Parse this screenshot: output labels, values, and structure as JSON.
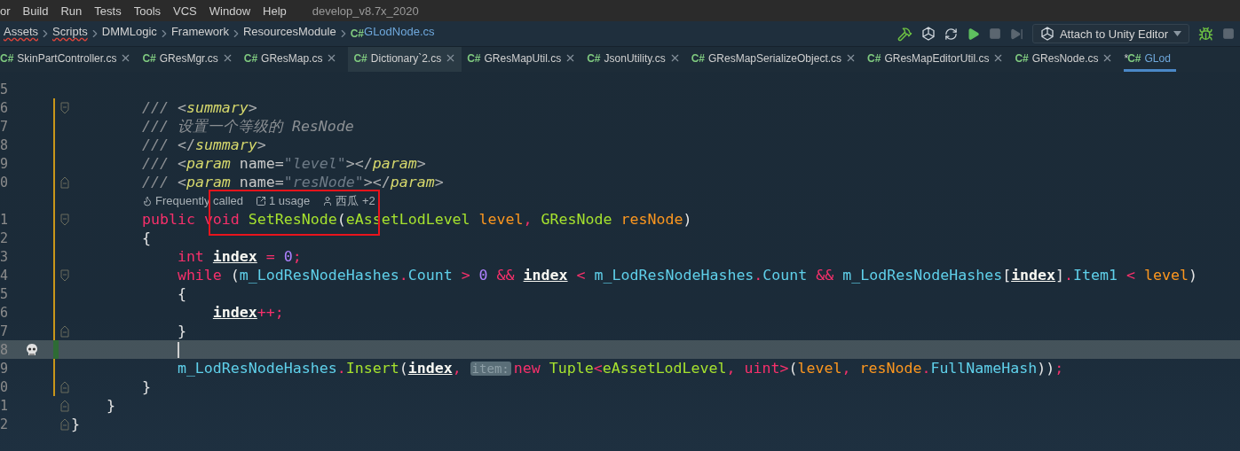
{
  "menu": {
    "items": [
      {
        "label": "or"
      },
      {
        "label": "Build"
      },
      {
        "label": "Run"
      },
      {
        "label": "Tests"
      },
      {
        "label": "Tools"
      },
      {
        "label": "VCS"
      },
      {
        "label": "Window"
      },
      {
        "label": "Help"
      }
    ],
    "project": "develop_v8.7x_2020"
  },
  "breadcrumb": [
    {
      "label": "Assets",
      "typo": true,
      "file": false
    },
    {
      "label": "Scripts",
      "typo": true,
      "file": false
    },
    {
      "label": "DMMLogic",
      "typo": false,
      "file": false
    },
    {
      "label": "Framework",
      "typo": false,
      "file": false
    },
    {
      "label": "ResourcesModule",
      "typo": false,
      "file": false
    },
    {
      "label": "GLodNode.cs",
      "typo": false,
      "file": true,
      "lang": "C#"
    }
  ],
  "toolbar": {
    "run_config": "Attach to Unity Editor"
  },
  "tabs": [
    {
      "lang": "C#",
      "label": "SkinPartController.cs",
      "selected": false,
      "hovered": false,
      "close": true
    },
    {
      "lang": "C#",
      "label": "GResMgr.cs",
      "selected": false,
      "hovered": false,
      "close": true
    },
    {
      "lang": "C#",
      "label": "GResMap.cs",
      "selected": false,
      "hovered": false,
      "close": true
    },
    {
      "lang": "C#",
      "label": "Dictionary`2.cs",
      "selected": false,
      "hovered": true,
      "close": true
    },
    {
      "lang": "C#",
      "label": "GResMapUtil.cs",
      "selected": false,
      "hovered": false,
      "close": true
    },
    {
      "lang": "C#",
      "label": "JsonUtility.cs",
      "selected": false,
      "hovered": false,
      "close": true
    },
    {
      "lang": "C#",
      "label": "GResMapSerializeObject.cs",
      "selected": false,
      "hovered": false,
      "close": true
    },
    {
      "lang": "C#",
      "label": "GResMapEditorUtil.cs",
      "selected": false,
      "hovered": false,
      "close": true
    },
    {
      "lang": "C#",
      "label": "GResNode.cs",
      "selected": false,
      "hovered": false,
      "close": true
    },
    {
      "lang": "C#",
      "label": "GLod",
      "selected": true,
      "hovered": false,
      "close": false,
      "modified_mark": "*"
    }
  ],
  "editor": {
    "lines": [
      {
        "kind": "code",
        "number": "5",
        "modified": false,
        "added": false,
        "fold_start": false,
        "fold_end": false,
        "current": false
      },
      {
        "kind": "code",
        "number": "6",
        "modified": true,
        "added": false,
        "fold_start": true,
        "fold_end": false,
        "current": false,
        "tokens": [
          {
            "kind": "comment",
            "text": "        /// "
          },
          {
            "kind": "tag_punct",
            "text": "<"
          },
          {
            "kind": "tag",
            "text": "summary"
          },
          {
            "kind": "tag_punct",
            "text": ">"
          }
        ]
      },
      {
        "kind": "code",
        "number": "7",
        "modified": true,
        "added": false,
        "fold_start": false,
        "fold_end": false,
        "current": false,
        "tokens": [
          {
            "kind": "comment",
            "text": "        /// 设置一个等级的 ResNode"
          }
        ]
      },
      {
        "kind": "code",
        "number": "8",
        "modified": true,
        "added": false,
        "fold_start": false,
        "fold_end": false,
        "current": false,
        "tokens": [
          {
            "kind": "comment",
            "text": "        /// "
          },
          {
            "kind": "tag_punct",
            "text": "</"
          },
          {
            "kind": "tag",
            "text": "summary"
          },
          {
            "kind": "tag_punct",
            "text": ">"
          }
        ]
      },
      {
        "kind": "code",
        "number": "9",
        "modified": true,
        "added": false,
        "fold_start": false,
        "fold_end": false,
        "current": false,
        "tokens": [
          {
            "kind": "comment",
            "text": "        /// "
          },
          {
            "kind": "tag_punct",
            "text": "<"
          },
          {
            "kind": "tag",
            "text": "param"
          },
          {
            "kind": "attr",
            "text": " name="
          },
          {
            "kind": "string",
            "text": "\"level\""
          },
          {
            "kind": "tag_punct",
            "text": "></"
          },
          {
            "kind": "tag",
            "text": "param"
          },
          {
            "kind": "tag_punct",
            "text": ">"
          }
        ]
      },
      {
        "kind": "code",
        "number": "0",
        "modified": true,
        "added": false,
        "fold_start": false,
        "fold_end": true,
        "current": false,
        "tokens": [
          {
            "kind": "comment",
            "text": "        /// "
          },
          {
            "kind": "tag_punct",
            "text": "<"
          },
          {
            "kind": "tag",
            "text": "param"
          },
          {
            "kind": "attr",
            "text": " name="
          },
          {
            "kind": "string",
            "text": "\"resNode\""
          },
          {
            "kind": "tag_punct",
            "text": "></"
          },
          {
            "kind": "tag",
            "text": "param"
          },
          {
            "kind": "tag_punct",
            "text": ">"
          }
        ]
      },
      {
        "kind": "code_vision",
        "modified": true,
        "added": false,
        "hints": [
          {
            "text": "Frequently called"
          },
          {
            "text": "1 usage"
          },
          {
            "text": "西瓜 +2"
          }
        ]
      },
      {
        "kind": "code",
        "number": "1",
        "modified": true,
        "added": false,
        "fold_start": true,
        "fold_end": false,
        "current": false,
        "tokens": [
          {
            "kind": "keyword",
            "text": "        public "
          },
          {
            "kind": "keyword",
            "text": "void "
          },
          {
            "kind": "method",
            "text": "SetResNode"
          },
          {
            "kind": "plain",
            "text": "("
          },
          {
            "kind": "type",
            "text": "eAssetLodLevel "
          },
          {
            "kind": "param",
            "text": "level"
          },
          {
            "kind": "operator",
            "text": ", "
          },
          {
            "kind": "type",
            "text": "GResNode "
          },
          {
            "kind": "param",
            "text": "resNode"
          },
          {
            "kind": "plain",
            "text": ")"
          }
        ]
      },
      {
        "kind": "code",
        "number": "2",
        "modified": true,
        "added": false,
        "fold_start": false,
        "fold_end": false,
        "current": false,
        "tokens": [
          {
            "kind": "plain",
            "text": "        {"
          }
        ]
      },
      {
        "kind": "code",
        "number": "3",
        "modified": true,
        "added": false,
        "fold_start": false,
        "fold_end": false,
        "current": false,
        "tokens": [
          {
            "kind": "keyword",
            "text": "            int "
          },
          {
            "kind": "local",
            "text": "index"
          },
          {
            "kind": "operator",
            "text": " = "
          },
          {
            "kind": "number",
            "text": "0"
          },
          {
            "kind": "operator",
            "text": ";"
          }
        ]
      },
      {
        "kind": "code",
        "number": "4",
        "modified": true,
        "added": false,
        "fold_start": true,
        "fold_end": false,
        "current": false,
        "tokens": [
          {
            "kind": "keyword",
            "text": "            while "
          },
          {
            "kind": "plain",
            "text": "("
          },
          {
            "kind": "field",
            "text": "m_LodResNodeHashes"
          },
          {
            "kind": "operator",
            "text": "."
          },
          {
            "kind": "field",
            "text": "Count"
          },
          {
            "kind": "operator",
            "text": " > "
          },
          {
            "kind": "number",
            "text": "0"
          },
          {
            "kind": "operator",
            "text": " && "
          },
          {
            "kind": "local",
            "text": "index"
          },
          {
            "kind": "operator",
            "text": " < "
          },
          {
            "kind": "field",
            "text": "m_LodResNodeHashes"
          },
          {
            "kind": "operator",
            "text": "."
          },
          {
            "kind": "field",
            "text": "Count"
          },
          {
            "kind": "operator",
            "text": " && "
          },
          {
            "kind": "field",
            "text": "m_LodResNodeHashes"
          },
          {
            "kind": "plain",
            "text": "["
          },
          {
            "kind": "local",
            "text": "index"
          },
          {
            "kind": "plain",
            "text": "]"
          },
          {
            "kind": "operator",
            "text": "."
          },
          {
            "kind": "field",
            "text": "Item1"
          },
          {
            "kind": "operator",
            "text": " < "
          },
          {
            "kind": "param",
            "text": "level"
          },
          {
            "kind": "plain",
            "text": ")"
          }
        ]
      },
      {
        "kind": "code",
        "number": "5",
        "modified": true,
        "added": false,
        "fold_start": false,
        "fold_end": false,
        "current": false,
        "tokens": [
          {
            "kind": "plain",
            "text": "            {"
          }
        ]
      },
      {
        "kind": "code",
        "number": "6",
        "modified": true,
        "added": false,
        "fold_start": false,
        "fold_end": false,
        "current": false,
        "tokens": [
          {
            "kind": "local",
            "text": "                index"
          },
          {
            "kind": "operator",
            "text": "++;"
          }
        ]
      },
      {
        "kind": "code",
        "number": "7",
        "modified": true,
        "added": false,
        "fold_start": false,
        "fold_end": true,
        "current": false,
        "tokens": [
          {
            "kind": "plain",
            "text": "            }"
          }
        ]
      },
      {
        "kind": "code",
        "number": "8",
        "modified": false,
        "added": true,
        "fold_start": false,
        "fold_end": false,
        "current": true
      },
      {
        "kind": "code",
        "number": "9",
        "modified": true,
        "added": false,
        "fold_start": false,
        "fold_end": false,
        "current": false,
        "tokens": [
          {
            "kind": "field",
            "text": "            m_LodResNodeHashes"
          },
          {
            "kind": "operator",
            "text": "."
          },
          {
            "kind": "method",
            "text": "Insert"
          },
          {
            "kind": "plain",
            "text": "("
          },
          {
            "kind": "local",
            "text": "index"
          },
          {
            "kind": "operator",
            "text": ", "
          },
          {
            "kind": "hint",
            "text": "item:"
          },
          {
            "kind": "keyword",
            "text": "new "
          },
          {
            "kind": "type",
            "text": "Tuple"
          },
          {
            "kind": "operator",
            "text": "<"
          },
          {
            "kind": "type",
            "text": "eAssetLodLevel"
          },
          {
            "kind": "operator",
            "text": ", "
          },
          {
            "kind": "keyword",
            "text": "uint"
          },
          {
            "kind": "operator",
            "text": ">"
          },
          {
            "kind": "plain",
            "text": "("
          },
          {
            "kind": "param",
            "text": "level"
          },
          {
            "kind": "operator",
            "text": ", "
          },
          {
            "kind": "param",
            "text": "resNode"
          },
          {
            "kind": "operator",
            "text": "."
          },
          {
            "kind": "field",
            "text": "FullNameHash"
          },
          {
            "kind": "plain",
            "text": "))"
          },
          {
            "kind": "operator",
            "text": ";"
          }
        ]
      },
      {
        "kind": "code",
        "number": "0",
        "modified": true,
        "added": false,
        "fold_start": false,
        "fold_end": true,
        "current": false,
        "tokens": [
          {
            "kind": "plain",
            "text": "        }"
          }
        ]
      },
      {
        "kind": "code",
        "number": "1",
        "modified": false,
        "added": false,
        "fold_start": false,
        "fold_end": true,
        "current": false,
        "tokens": [
          {
            "kind": "plain",
            "text": "    }"
          }
        ]
      },
      {
        "kind": "code",
        "number": "2",
        "modified": false,
        "added": false,
        "fold_start": false,
        "fold_end": true,
        "current": false,
        "tokens": [
          {
            "kind": "plain",
            "text": "}"
          }
        ]
      }
    ]
  }
}
